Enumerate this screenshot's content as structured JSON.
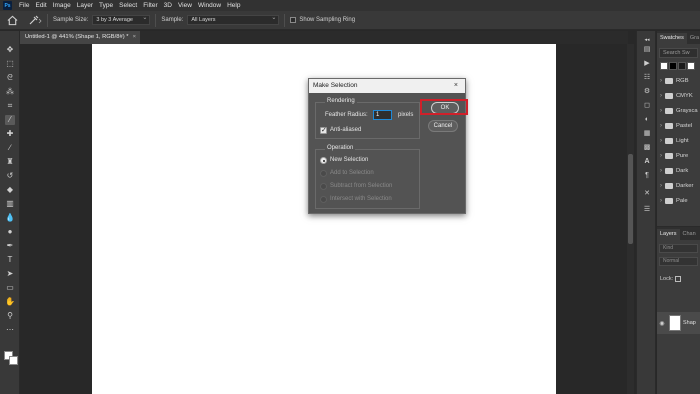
{
  "app": {
    "logo": "Ps"
  },
  "menubar": {
    "items": [
      "File",
      "Edit",
      "Image",
      "Layer",
      "Type",
      "Select",
      "Filter",
      "3D",
      "View",
      "Window",
      "Help"
    ]
  },
  "options": {
    "sample_size_label": "Sample Size:",
    "sample_size_value": "3 by 3 Average",
    "sample_label": "Sample:",
    "sample_value": "All Layers",
    "show_ring_label": "Show Sampling Ring"
  },
  "document": {
    "tab_title": "Untitled-1 @ 441% (Shape 1, RGB/8#) *",
    "tab_close": "×"
  },
  "dialog": {
    "title": "Make Selection",
    "close": "×",
    "rendering_label": "Rendering",
    "feather_label": "Feather Radius:",
    "feather_value": "1",
    "feather_unit": "pixels",
    "anti_aliased_label": "Anti-aliased",
    "operation_label": "Operation",
    "op_new": "New Selection",
    "op_add": "Add to Selection",
    "op_subtract": "Subtract from Selection",
    "op_intersect": "Intersect with Selection",
    "ok_label": "OK",
    "cancel_label": "Cancel"
  },
  "swatches_panel": {
    "tabs": [
      "Swatches",
      "Gra"
    ],
    "search_placeholder": "Search Sw",
    "folders": [
      "RGB",
      "CMYK",
      "Graysca",
      "Pastel",
      "Light",
      "Pure",
      "Dark",
      "Darker",
      "Pale"
    ],
    "colors": [
      "#ffffff",
      "#000000",
      "#1a1a1a",
      "#ffffff"
    ]
  },
  "layers_panel": {
    "tabs": [
      "Layers",
      "Chan"
    ],
    "kind_placeholder": "Kind",
    "blend_mode": "Normal",
    "lock_label": "Lock:",
    "layer_name": "Shap"
  }
}
